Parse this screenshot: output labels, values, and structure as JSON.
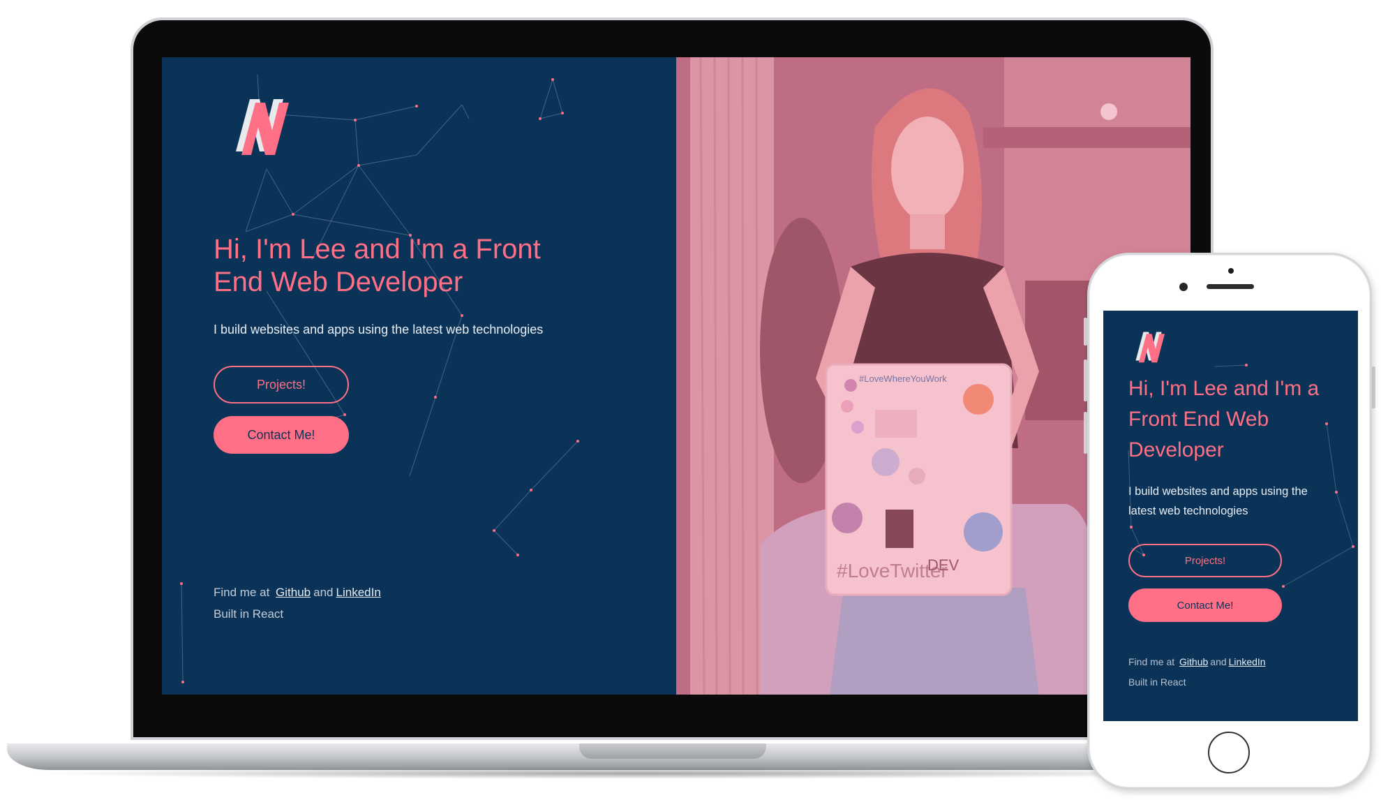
{
  "desktop": {
    "logo_letter": "N",
    "title": "Hi, I'm Lee and I'm a Front End Web Developer",
    "subtitle": "I build websites and apps using the latest web technologies",
    "projects_button": "Projects!",
    "contact_button": "Contact Me!",
    "find_me_prefix": "Find me at",
    "github_link": "Github",
    "and_text": "and",
    "linkedin_link": "LinkedIn",
    "built_with": "Built in React",
    "photo_laptop_sticker": "#LoveTwitter",
    "photo_laptop_sticker_dev": "DEV",
    "photo_top_sticker": "#LoveWhereYouWork"
  },
  "mobile": {
    "title": "Hi, I'm Lee and I'm a Front End Web Developer",
    "subtitle": "I build websites and apps using the latest web technologies",
    "projects_button": "Projects!",
    "contact_button": "Contact Me!",
    "find_me_prefix": "Find me at",
    "github_link": "Github",
    "and_text": "and",
    "linkedin_link": "LinkedIn",
    "built_with": "Built in React"
  },
  "colors": {
    "background_navy": "#0b3357",
    "accent_pink": "#ff6f85",
    "photo_overlay": "#b36f82"
  },
  "icons": {
    "logo": "n-logo-icon"
  }
}
